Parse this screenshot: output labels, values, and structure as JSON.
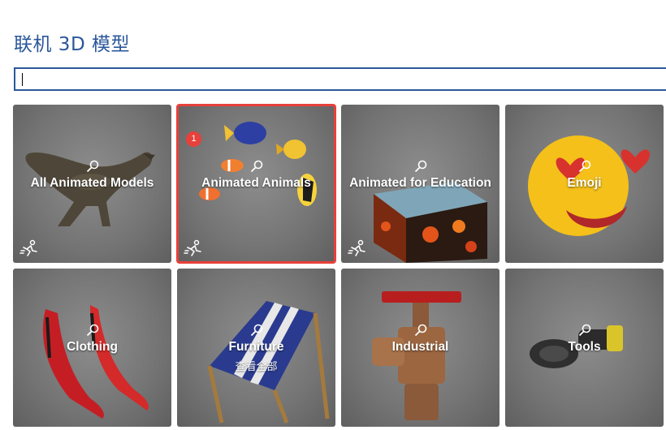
{
  "header": {
    "title": "联机 3D 模型"
  },
  "search": {
    "value": ""
  },
  "tiles": [
    {
      "label": "All Animated Models",
      "animated": true
    },
    {
      "label": "Animated Animals",
      "animated": true,
      "selected": true,
      "badge": "1"
    },
    {
      "label": "Animated for Education",
      "animated": true
    },
    {
      "label": "Emoji",
      "animated": false
    },
    {
      "label": "Clothing",
      "animated": false
    },
    {
      "label": "Furniture",
      "sub": "查看全部",
      "animated": false
    },
    {
      "label": "Industrial",
      "animated": false
    },
    {
      "label": "Tools",
      "animated": false
    }
  ],
  "colors": {
    "accent": "#2b579a",
    "selection": "#e8403a",
    "tile_bg": "#747474"
  }
}
